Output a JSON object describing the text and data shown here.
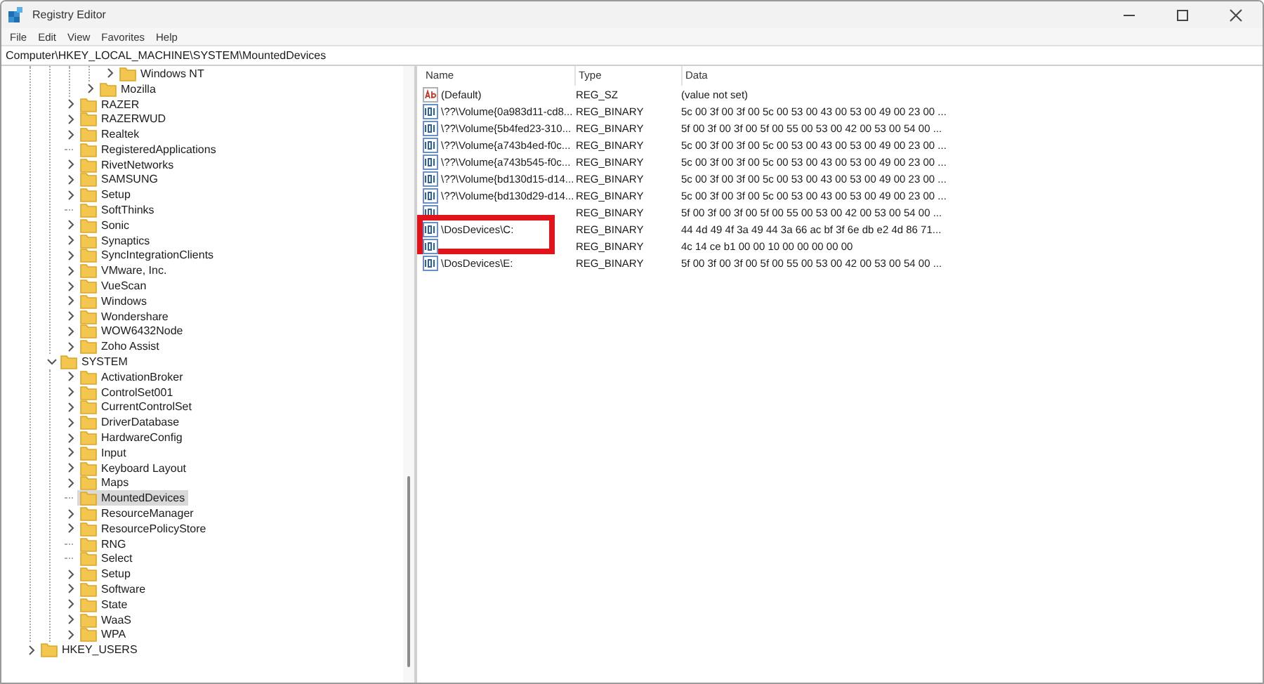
{
  "window": {
    "title": "Registry Editor"
  },
  "menu": [
    "File",
    "Edit",
    "View",
    "Favorites",
    "Help"
  ],
  "address": "Computer\\HKEY_LOCAL_MACHINE\\SYSTEM\\MountedDevices",
  "tree": [
    {
      "children": [
        {
          "children": [
            {
              "children": [
                {
                  "children": [
                    {
                      "label": "Windows NT",
                      "has_children": true,
                      "expanded": false,
                      "selected": false
                    }
                  ]
                },
                {
                  "label": "Mozilla",
                  "has_children": true,
                  "expanded": false,
                  "selected": false
                }
              ]
            },
            {
              "label": "RAZER",
              "has_children": true,
              "expanded": false,
              "selected": false
            },
            {
              "label": "RAZERWUD",
              "has_children": true,
              "expanded": false,
              "selected": false
            },
            {
              "label": "Realtek",
              "has_children": true,
              "expanded": false,
              "selected": false
            },
            {
              "label": "RegisteredApplications",
              "has_children": false,
              "selected": false
            },
            {
              "label": "RivetNetworks",
              "has_children": true,
              "expanded": false,
              "selected": false
            },
            {
              "label": "SAMSUNG",
              "has_children": true,
              "expanded": false,
              "selected": false
            },
            {
              "label": "Setup",
              "has_children": true,
              "expanded": false,
              "selected": false
            },
            {
              "label": "SoftThinks",
              "has_children": false,
              "selected": false
            },
            {
              "label": "Sonic",
              "has_children": true,
              "expanded": false,
              "selected": false
            },
            {
              "label": "Synaptics",
              "has_children": true,
              "expanded": false,
              "selected": false
            },
            {
              "label": "SyncIntegrationClients",
              "has_children": true,
              "expanded": false,
              "selected": false
            },
            {
              "label": "VMware, Inc.",
              "has_children": true,
              "expanded": false,
              "selected": false
            },
            {
              "label": "VueScan",
              "has_children": true,
              "expanded": false,
              "selected": false
            },
            {
              "label": "Windows",
              "has_children": true,
              "expanded": false,
              "selected": false
            },
            {
              "label": "Wondershare",
              "has_children": true,
              "expanded": false,
              "selected": false
            },
            {
              "label": "WOW6432Node",
              "has_children": true,
              "expanded": false,
              "selected": false
            },
            {
              "label": "Zoho Assist",
              "has_children": true,
              "expanded": false,
              "selected": false
            }
          ]
        },
        {
          "label": "SYSTEM",
          "has_children": true,
          "expanded": true,
          "selected": false,
          "children": [
            {
              "label": "ActivationBroker",
              "has_children": true,
              "expanded": false,
              "selected": false
            },
            {
              "label": "ControlSet001",
              "has_children": true,
              "expanded": false,
              "selected": false
            },
            {
              "label": "CurrentControlSet",
              "has_children": true,
              "expanded": false,
              "selected": false
            },
            {
              "label": "DriverDatabase",
              "has_children": true,
              "expanded": false,
              "selected": false
            },
            {
              "label": "HardwareConfig",
              "has_children": true,
              "expanded": false,
              "selected": false
            },
            {
              "label": "Input",
              "has_children": true,
              "expanded": false,
              "selected": false
            },
            {
              "label": "Keyboard Layout",
              "has_children": true,
              "expanded": false,
              "selected": false
            },
            {
              "label": "Maps",
              "has_children": true,
              "expanded": false,
              "selected": false
            },
            {
              "label": "MountedDevices",
              "has_children": false,
              "selected": true
            },
            {
              "label": "ResourceManager",
              "has_children": true,
              "expanded": false,
              "selected": false
            },
            {
              "label": "ResourcePolicyStore",
              "has_children": true,
              "expanded": false,
              "selected": false
            },
            {
              "label": "RNG",
              "has_children": false,
              "selected": false
            },
            {
              "label": "Select",
              "has_children": false,
              "selected": false
            },
            {
              "label": "Setup",
              "has_children": true,
              "expanded": false,
              "selected": false
            },
            {
              "label": "Software",
              "has_children": true,
              "expanded": false,
              "selected": false
            },
            {
              "label": "State",
              "has_children": true,
              "expanded": false,
              "selected": false
            },
            {
              "label": "WaaS",
              "has_children": true,
              "expanded": false,
              "selected": false
            },
            {
              "label": "WPA",
              "has_children": true,
              "expanded": false,
              "selected": false
            }
          ]
        }
      ]
    },
    {
      "label": "HKEY_USERS",
      "has_children": true,
      "expanded": false,
      "selected": false
    }
  ],
  "table": {
    "columns": [
      "Name",
      "Type",
      "Data"
    ],
    "rows": [
      {
        "kind": "string",
        "name": "(Default)",
        "type": "REG_SZ",
        "data": "(value not set)",
        "highlighted": false
      },
      {
        "kind": "binary",
        "name": "\\??\\Volume{0a983d11-cd8...",
        "type": "REG_BINARY",
        "data": "5c 00 3f 00 3f 00 5c 00 53 00 43 00 53 00 49 00 23 00 ...",
        "highlighted": false
      },
      {
        "kind": "binary",
        "name": "\\??\\Volume{5b4fed23-310...",
        "type": "REG_BINARY",
        "data": "5f 00 3f 00 3f 00 5f 00 55 00 53 00 42 00 53 00 54 00 ...",
        "highlighted": false
      },
      {
        "kind": "binary",
        "name": "\\??\\Volume{a743b4ed-f0c...",
        "type": "REG_BINARY",
        "data": "5c 00 3f 00 3f 00 5c 00 53 00 43 00 53 00 49 00 23 00 ...",
        "highlighted": false
      },
      {
        "kind": "binary",
        "name": "\\??\\Volume{a743b545-f0c...",
        "type": "REG_BINARY",
        "data": "5c 00 3f 00 3f 00 5c 00 53 00 43 00 53 00 49 00 23 00 ...",
        "highlighted": false
      },
      {
        "kind": "binary",
        "name": "\\??\\Volume{bd130d15-d14...",
        "type": "REG_BINARY",
        "data": "5c 00 3f 00 3f 00 5c 00 53 00 43 00 53 00 49 00 23 00 ...",
        "highlighted": false
      },
      {
        "kind": "binary",
        "name": "\\??\\Volume{bd130d29-d14...",
        "type": "REG_BINARY",
        "data": "5c 00 3f 00 3f 00 5c 00 53 00 43 00 53 00 49 00 23 00 ...",
        "highlighted": false
      },
      {
        "kind": "binary",
        "type": "REG_BINARY",
        "data": "5f 00 3f 00 3f 00 5f 00 55 00 53 00 42 00 53 00 54 00 ...",
        "highlighted": false
      },
      {
        "kind": "binary",
        "name": "\\DosDevices\\C:",
        "type": "REG_BINARY",
        "data": "44 4d 49 4f 3a 49 44 3a 66 ac bf 3f 6e db e2 4d 86 71...",
        "highlighted": true
      },
      {
        "kind": "binary",
        "type": "REG_BINARY",
        "data": "4c 14 ce b1 00 00 10 00 00 00 00 00",
        "highlighted": false
      },
      {
        "kind": "binary",
        "name": "\\DosDevices\\E:",
        "type": "REG_BINARY",
        "data": "5f 00 3f 00 3f 00 5f 00 55 00 53 00 42 00 53 00 54 00 ...",
        "highlighted": false
      }
    ]
  }
}
